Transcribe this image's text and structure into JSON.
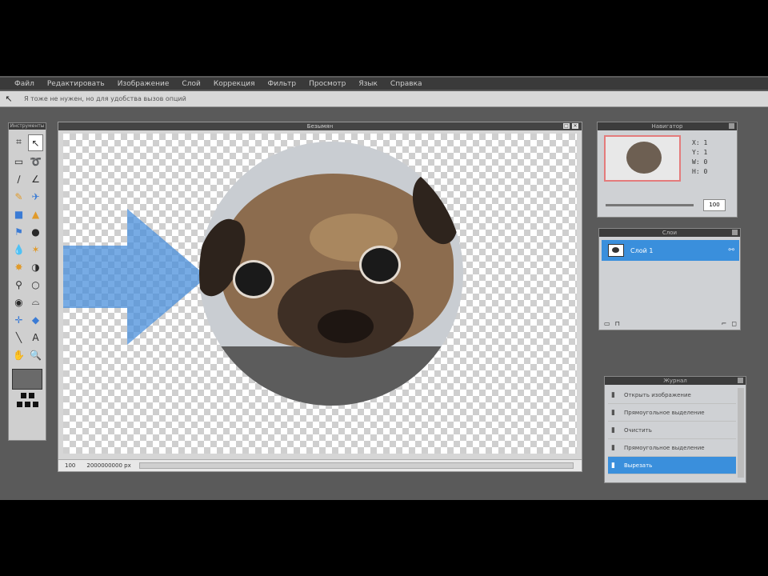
{
  "menu": {
    "items": [
      "Файл",
      "Редактировать",
      "Изображение",
      "Слой",
      "Коррекция",
      "Фильтр",
      "Просмотр",
      "Язык",
      "Справка"
    ]
  },
  "options": {
    "hint": "Я тоже не нужен, но для удобства вызов опций"
  },
  "tools_panel": {
    "title": "Инструменты"
  },
  "document": {
    "title": "Безымян",
    "status_zoom": "100",
    "status_size": "2000000000 px"
  },
  "navigator": {
    "title": "Навигатор",
    "readout": [
      "X: 1",
      "Y: 1",
      "W: 0",
      "H: 0"
    ],
    "zoom_value": "100"
  },
  "layers": {
    "title": "Слои",
    "active_layer": "Слой 1",
    "footer_icons": [
      "▭",
      "⊓",
      "□",
      "⌐",
      "◻"
    ]
  },
  "history": {
    "title": "Журнал",
    "items": [
      "Открыть изображение",
      "Прямоугольное выделение",
      "Очистить",
      "Прямоугольное выделение",
      "Вырезать"
    ],
    "active_index": 4
  },
  "colors": {
    "accent_line": "#b36a3a",
    "selection_blue": "#3a8fdc",
    "arrow_blue": "#4a8fdc"
  }
}
